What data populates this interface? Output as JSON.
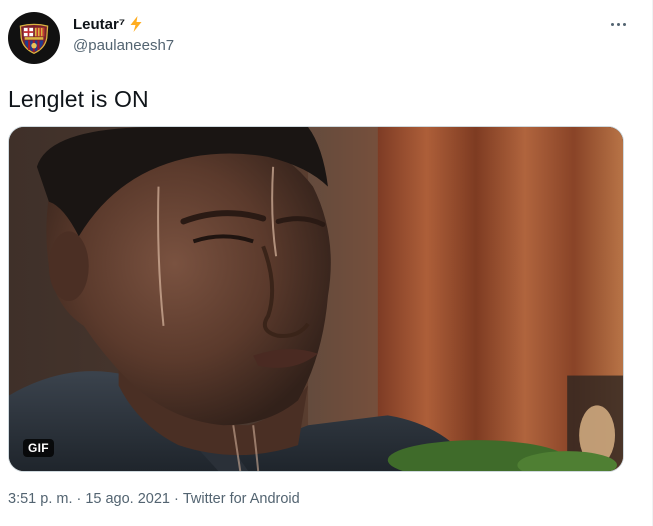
{
  "author": {
    "display_name": "Leutar⁷",
    "handle": "@paulaneesh7",
    "verified_badge_icon": "lightning-bolt-icon"
  },
  "menu": {
    "icon": "more-options-icon"
  },
  "tweet": {
    "text": "Lenglet is ON"
  },
  "media": {
    "type": "gif",
    "badge": "GIF"
  },
  "meta": {
    "time": "3:51 p. m.",
    "separator": "·",
    "date": "15 ago. 2021",
    "source": "Twitter for Android"
  },
  "colors": {
    "text_primary": "#0f1419",
    "text_secondary": "#536471",
    "bolt": "#ffad1f"
  }
}
